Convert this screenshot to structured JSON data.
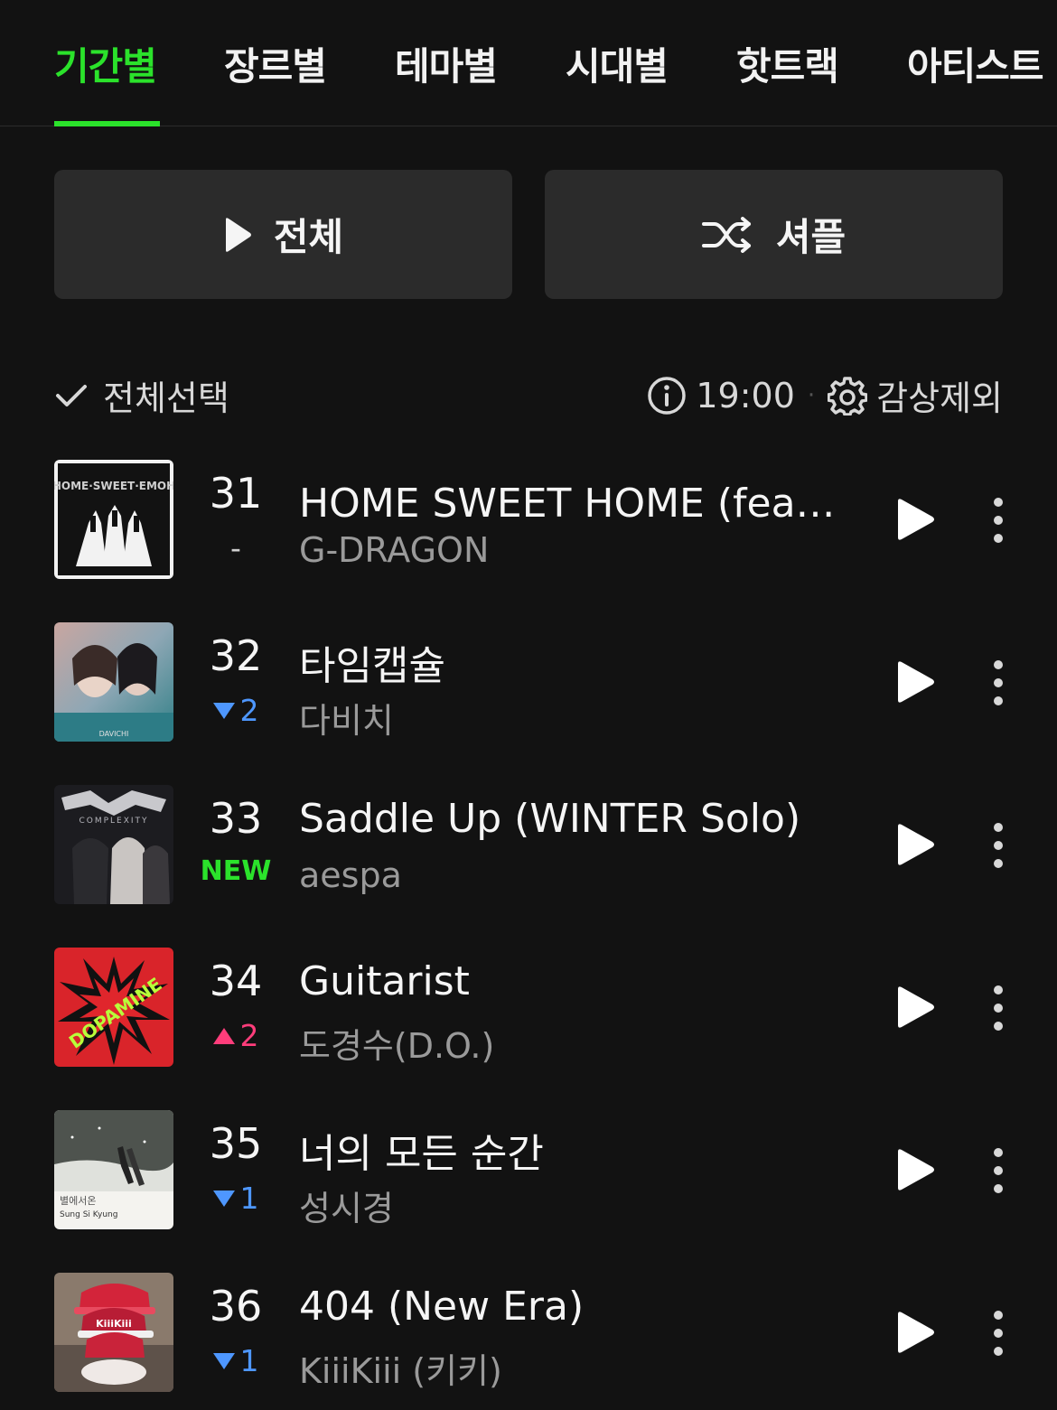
{
  "tabs": [
    "기간별",
    "장르별",
    "테마별",
    "시대별",
    "핫트랙",
    "아티스트"
  ],
  "actions": {
    "play_all": "전체",
    "shuffle": "셔플"
  },
  "toolbar": {
    "select_all": "전체선택",
    "time": "19:00",
    "separator": "·",
    "exclude": "감상제외"
  },
  "colors": {
    "accent": "#2be22b",
    "down": "#4e97ff",
    "up": "#ff3d7b",
    "background": "#121212",
    "button": "#2b2b2b"
  },
  "tracks": [
    {
      "rank": "31",
      "change": "-",
      "change_type": "same",
      "title": "HOME SWEET HOME (feat. 태양, 대성)",
      "artist": "G-DRAGON",
      "cover_text": "HOME·SWEET·EMOH"
    },
    {
      "rank": "32",
      "change": "2",
      "change_type": "down",
      "title": "타임캡슐",
      "artist": "다비치",
      "cover_text": "DAVICHI"
    },
    {
      "rank": "33",
      "change": "NEW",
      "change_type": "new",
      "title": "Saddle Up (WINTER Solo)",
      "artist": "aespa",
      "cover_text": "COMPLEXITY"
    },
    {
      "rank": "34",
      "change": "2",
      "change_type": "up",
      "title": "Guitarist",
      "artist": "도경수(D.O.)",
      "cover_text": "DOPAMINE"
    },
    {
      "rank": "35",
      "change": "1",
      "change_type": "down",
      "title": "너의 모든 순간",
      "artist": "성시경",
      "cover_text": "Sung Si Kyung"
    },
    {
      "rank": "36",
      "change": "1",
      "change_type": "down",
      "title": "404 (New Era)",
      "artist": "KiiiKiii (키키)",
      "cover_text": "KiiiKiii"
    }
  ]
}
